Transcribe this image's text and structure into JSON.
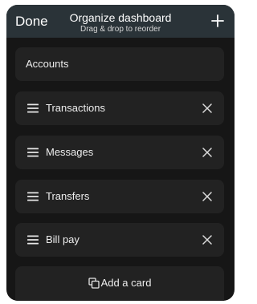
{
  "header": {
    "done_label": "Done",
    "title": "Organize dashboard",
    "subtitle": "Drag & drop to reorder",
    "add_icon": "plus-icon"
  },
  "accounts_card": {
    "label": "Accounts"
  },
  "cards": [
    {
      "label": "Transactions",
      "handle_icon": "drag-handle-icon",
      "remove_icon": "close-icon"
    },
    {
      "label": "Messages",
      "handle_icon": "drag-handle-icon",
      "remove_icon": "close-icon"
    },
    {
      "label": "Transfers",
      "handle_icon": "drag-handle-icon",
      "remove_icon": "close-icon"
    },
    {
      "label": "Bill pay",
      "handle_icon": "drag-handle-icon",
      "remove_icon": "close-icon"
    }
  ],
  "add_card": {
    "label": "Add a card",
    "icon": "copy-cards-icon"
  },
  "colors": {
    "header_bg": "#2a3338",
    "screen_bg": "#161616",
    "card_bg": "#222222",
    "text": "#eeeeee"
  }
}
